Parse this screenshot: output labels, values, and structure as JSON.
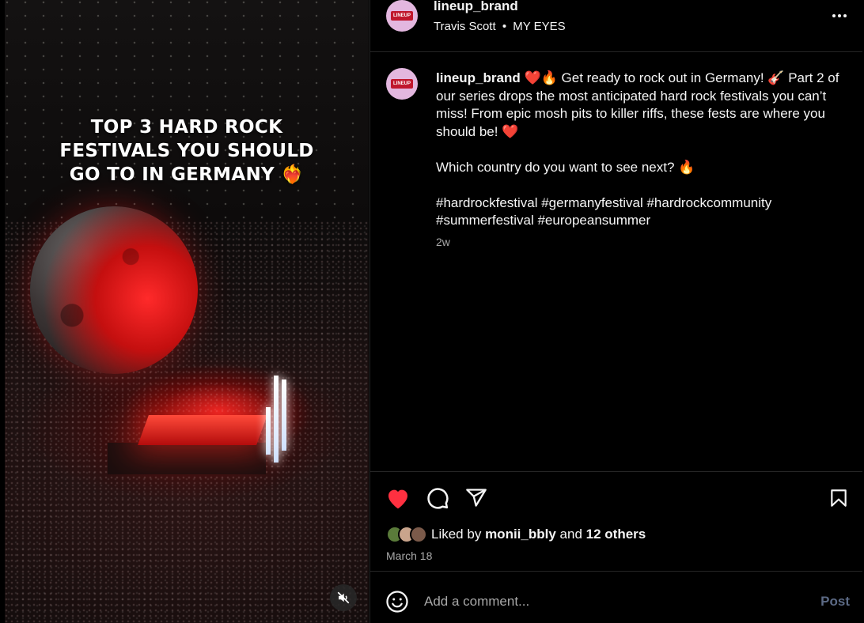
{
  "media": {
    "overlay_lines": [
      "TOP 3 HARD ROCK",
      "FESTIVALS YOU SHOULD",
      "GO TO IN GERMANY ❤️‍🔥"
    ],
    "mute_icon": "speaker-muted-icon"
  },
  "header": {
    "username": "lineup_brand",
    "audio_artist": "Travis Scott",
    "audio_separator": "•",
    "audio_track": "MY EYES",
    "more_icon": "more-options-icon",
    "avatar_text": "LINEUP"
  },
  "caption": {
    "username": "lineup_brand",
    "emoji_1": "❤️",
    "emoji_2": "🔥",
    "text_1": " Get ready to rock out in Germany! ",
    "emoji_3": "🎸",
    "text_2": " Part 2 of our series drops the most anticipated hard rock festivals you can’t miss! From epic mosh pits to killer riffs, these fests are where you should be! ",
    "emoji_4": "❤️",
    "question": "Which country do you want to see next? ",
    "emoji_5": "🔥",
    "hashtags": "#hardrockfestival #germanyfestival #hardrockcommunity #summerfestival #europeansummer",
    "time_ago": "2w"
  },
  "actions": {
    "like_icon": "heart-filled-icon",
    "comment_icon": "comment-icon",
    "share_icon": "share-icon",
    "save_icon": "bookmark-icon",
    "like_color": "#ff3040"
  },
  "likes": {
    "prefix": "Liked by",
    "first_user": "monii_bbly",
    "middle": "and",
    "others": "12 others",
    "date": "March 18"
  },
  "comment": {
    "placeholder": "Add a comment...",
    "post_label": "Post",
    "emoji_icon": "emoji-icon"
  }
}
